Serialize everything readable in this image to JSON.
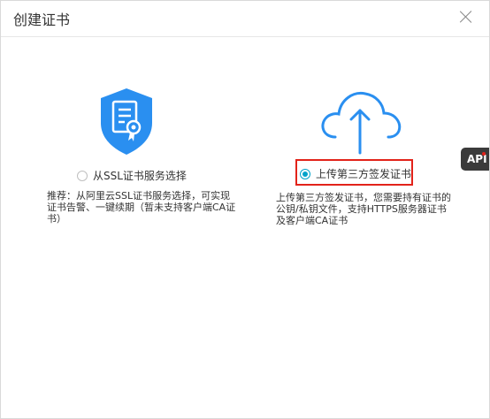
{
  "dialog": {
    "title": "创建证书"
  },
  "options": {
    "left": {
      "label": "从SSL证书服务选择",
      "description": "推荐：从阿里云SSL证书服务选择，可实现证书告警、一键续期（暂未支持客户端CA证书）"
    },
    "right": {
      "label": "上传第三方签发证书",
      "description": "上传第三方签发证书，您需要持有证书的公钥/私钥文件，支持HTTPS服务器证书及客户端CA证书"
    }
  },
  "side_tab": {
    "label": "API"
  },
  "colors": {
    "accent": "#00a2ca",
    "shield": "#2a8ff0",
    "highlight": "#e2231a",
    "text": "#333333"
  }
}
